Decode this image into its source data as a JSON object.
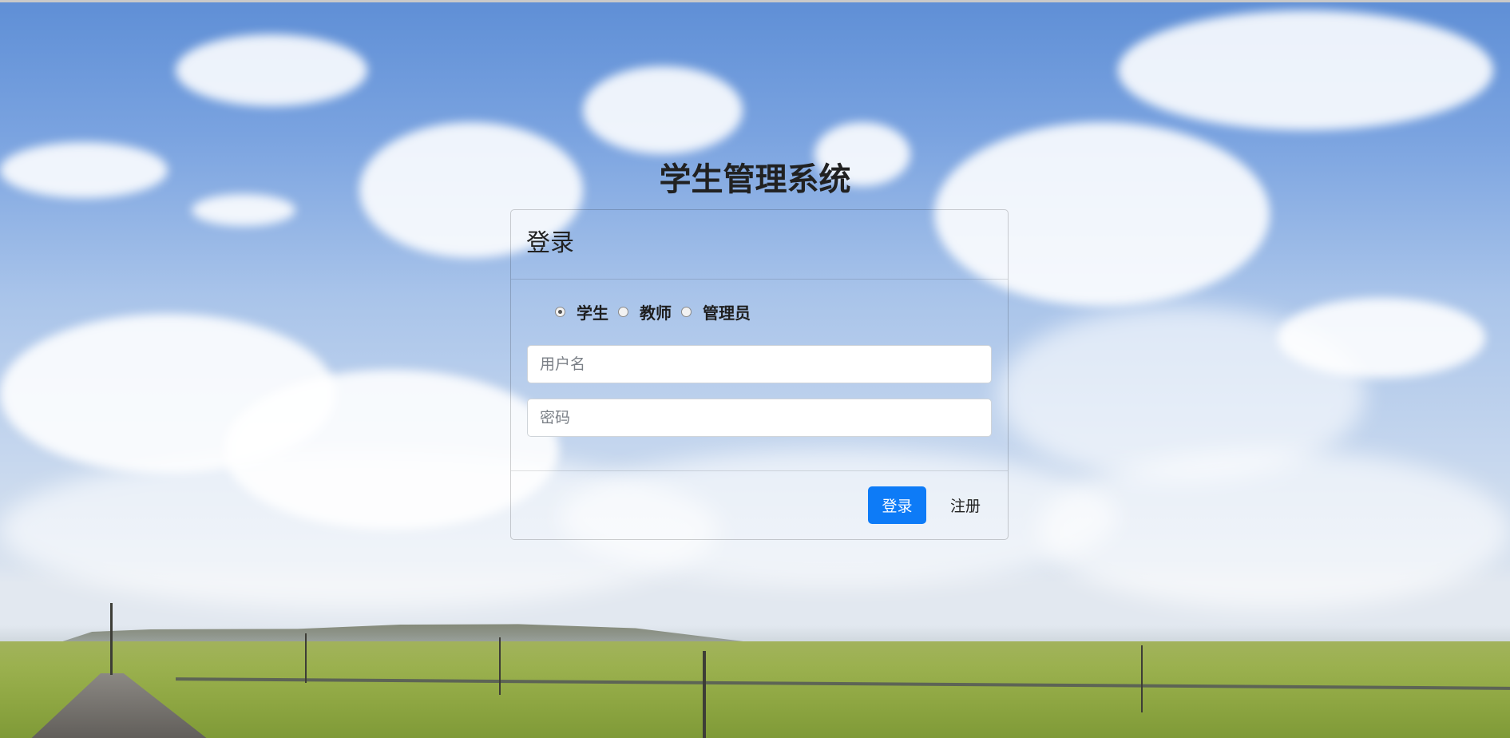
{
  "page": {
    "title": "学生管理系统"
  },
  "login_card": {
    "header_title": "登录",
    "roles": [
      {
        "label": "学生",
        "checked": true
      },
      {
        "label": "教师",
        "checked": false
      },
      {
        "label": "管理员",
        "checked": false
      }
    ],
    "username": {
      "value": "",
      "placeholder": "用户名"
    },
    "password": {
      "value": "",
      "placeholder": "密码"
    },
    "login_button_label": "登录",
    "register_button_label": "注册"
  },
  "colors": {
    "primary": "#0d7bf7",
    "title_text": "#212121"
  }
}
